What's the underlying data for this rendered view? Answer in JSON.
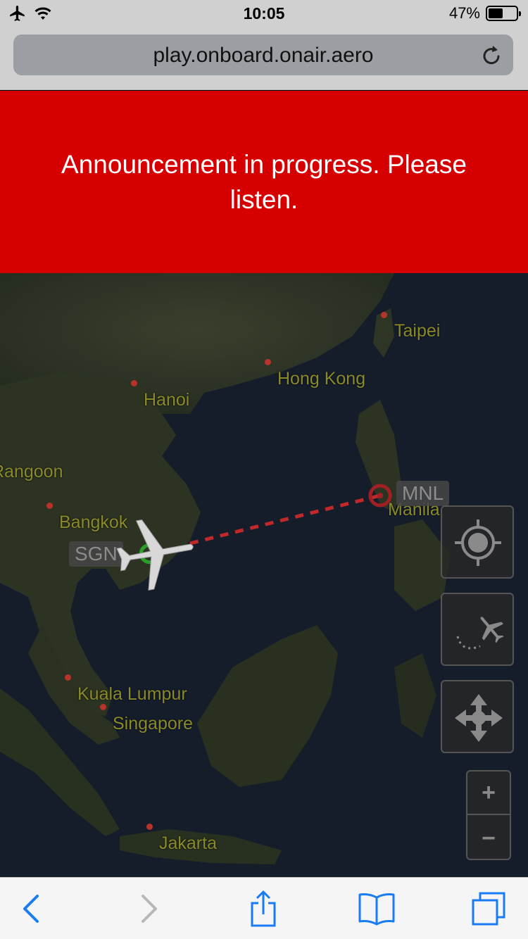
{
  "status_bar": {
    "time": "10:05",
    "battery_percent_text": "47%",
    "battery_level": 0.47,
    "icons": [
      "airplane-mode-icon",
      "wifi-icon",
      "battery-icon"
    ]
  },
  "browser": {
    "url": "play.onboard.onair.aero",
    "reload_icon": "reload-icon"
  },
  "announcement": {
    "text": "Announcement in progress. Please listen.",
    "background": "#d60000"
  },
  "map": {
    "cities": {
      "taipei": "Taipei",
      "hong_kong": "Hong Kong",
      "hanoi": "Hanoi",
      "rangoon": "Rangoon",
      "bangkok": "Bangkok",
      "manila": "Manila",
      "kuala_lumpur": "Kuala Lumpur",
      "singapore": "Singapore",
      "jakarta": "Jakarta"
    },
    "origin_code": "SGN",
    "destination_code": "MNL",
    "controls": {
      "locate_icon": "crosshair-locate-icon",
      "flight_path_icon": "flight-path-icon",
      "pan_icon": "pan-arrows-icon",
      "zoom_in": "+",
      "zoom_out": "−"
    }
  },
  "toolbar": {
    "back_icon": "chevron-left-icon",
    "forward_icon": "chevron-right-icon",
    "share_icon": "share-icon",
    "bookmarks_icon": "book-icon",
    "tabs_icon": "tabs-icon"
  },
  "colors": {
    "ios_blue": "#1a7cf5",
    "route_red": "#c0282a"
  }
}
